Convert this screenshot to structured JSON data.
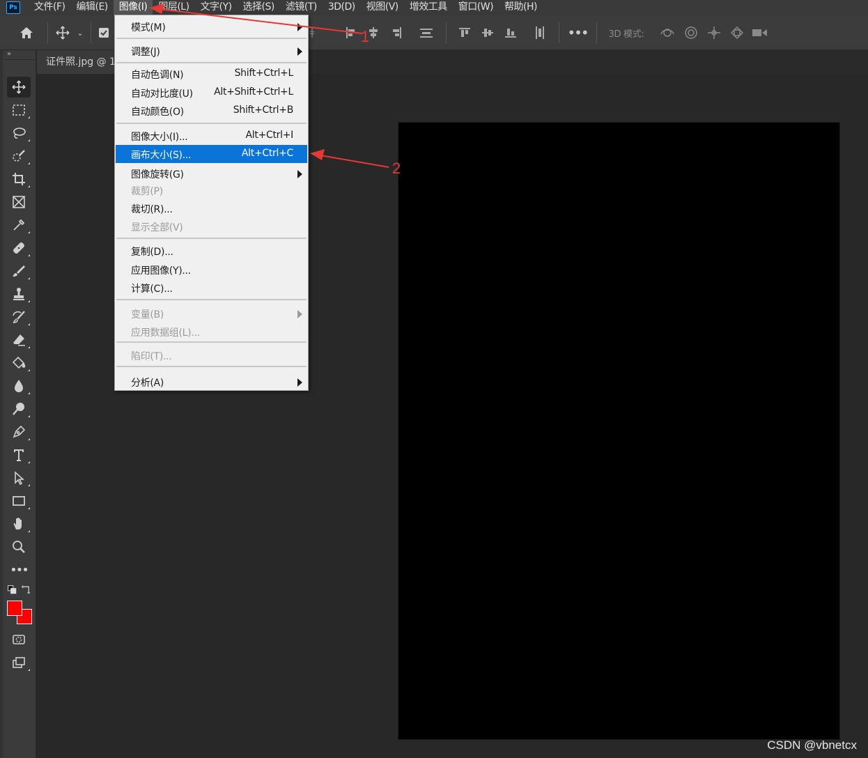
{
  "app": {
    "logo_text": "Ps"
  },
  "menubar": {
    "items": [
      "文件(F)",
      "编辑(E)",
      "图像(I)",
      "图层(L)",
      "文字(Y)",
      "选择(S)",
      "滤镜(T)",
      "3D(D)",
      "视图(V)",
      "增效工具",
      "窗口(W)",
      "帮助(H)"
    ],
    "active": "图像(I)"
  },
  "options_bar": {
    "mode_3d_label": "3D 模式:"
  },
  "toolbar": {
    "collapse_label": "»"
  },
  "document": {
    "tab_title": "证件照.jpg @ 1"
  },
  "colors": {
    "foreground": "#ff0000",
    "background": "#ff0000",
    "highlight": "#0a74d8",
    "annotation": "#e53935"
  },
  "image_menu": {
    "items": [
      {
        "label": "模式(M)",
        "submenu": true
      },
      {
        "label": "调整(J)",
        "submenu": true
      },
      {
        "label": "自动色调(N)",
        "shortcut": "Shift+Ctrl+L"
      },
      {
        "label": "自动对比度(U)",
        "shortcut": "Alt+Shift+Ctrl+L"
      },
      {
        "label": "自动颜色(O)",
        "shortcut": "Shift+Ctrl+B"
      },
      {
        "label": "图像大小(I)...",
        "shortcut": "Alt+Ctrl+I"
      },
      {
        "label": "画布大小(S)...",
        "shortcut": "Alt+Ctrl+C",
        "highlighted": true
      },
      {
        "label": "图像旋转(G)",
        "submenu": true
      },
      {
        "label": "裁剪(P)",
        "disabled": true
      },
      {
        "label": "裁切(R)..."
      },
      {
        "label": "显示全部(V)",
        "disabled": true
      },
      {
        "label": "复制(D)..."
      },
      {
        "label": "应用图像(Y)..."
      },
      {
        "label": "计算(C)..."
      },
      {
        "label": "变量(B)",
        "submenu": true,
        "disabled": true
      },
      {
        "label": "应用数据组(L)...",
        "disabled": true
      },
      {
        "label": "陷印(T)...",
        "disabled": true
      },
      {
        "label": "分析(A)",
        "submenu": true
      }
    ]
  },
  "annotations": {
    "step1": "1",
    "step2": "2"
  },
  "watermark": "CSDN @vbnetcx"
}
